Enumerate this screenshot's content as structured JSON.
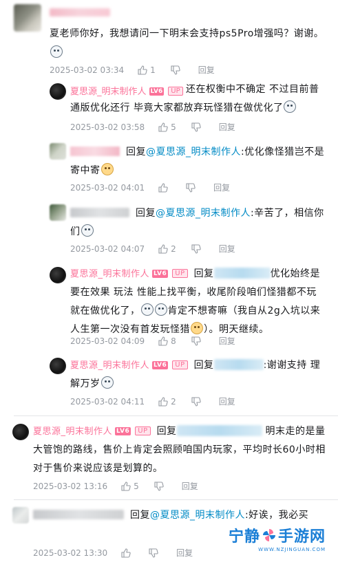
{
  "main_comment": {
    "text": "夏老师你好，我想请问一下明末会支持ps5Pro增强吗？谢谢。",
    "time": "2025-03-02 03:34",
    "likes": "1",
    "reply_label": "回复"
  },
  "replies": [
    {
      "nickname": "夏思源_明末制作人",
      "level": "LV6",
      "up": "UP",
      "text": "还在权衡中不确定 不过目前普通版优化还行 毕竟大家都放弃玩怪猎在做优化了",
      "time": "2025-03-02 03:58",
      "likes": "5",
      "reply_label": "回复"
    },
    {
      "prefix": "回复",
      "mention": "@夏思源_明末制作人",
      "text": ":优化像怪猎岂不是寄中寄",
      "time": "2025-03-02 04:01",
      "likes": "",
      "reply_label": "回复"
    },
    {
      "prefix": "回复",
      "mention": "@夏思源_明末制作人",
      "text": ":辛苦了，相信你们",
      "time": "2025-03-02 04:07",
      "likes": "2",
      "reply_label": "回复"
    },
    {
      "nickname": "夏思源_明末制作人",
      "level": "LV6",
      "up": "UP",
      "prefix": "回复",
      "text_a": "优化始终是要在效果 玩法 性能上找平衡，收尾阶段咱们怪猎都不玩就在做优化了，",
      "text_b": "肯定不想寄嘛（我自从2g入坑以来人生第一次没有首发玩怪猎",
      "text_c": "）。明天继续。",
      "time": "2025-03-02 04:09",
      "likes": "8",
      "reply_label": "回复"
    },
    {
      "nickname": "夏思源_明末制作人",
      "level": "LV6",
      "up": "UP",
      "prefix": "回复",
      "text": ":谢谢支持 理解万岁",
      "time": "2025-03-02 04:11",
      "likes": "2",
      "reply_label": "回复"
    }
  ],
  "comment_2": {
    "nickname": "夏思源_明末制作人",
    "level": "LV6",
    "up": "UP",
    "prefix": "回复",
    "text_a": "明末走的是量大管饱的路线，售价上肯定会照顾咱国内玩家，平均时长60小时相对于售价来说应该是划算的。",
    "time": "2025-03-02 13:16",
    "likes": "5",
    "reply_label": "回复"
  },
  "comment_3": {
    "prefix": "回复",
    "mention": "@夏思源_明末制作人",
    "text": ":好诶，我必买",
    "time": "2025-03-02 13:30",
    "likes": "",
    "reply_label": "回复"
  },
  "watermark": {
    "main_left": "宁静",
    "main_right": "手游网",
    "sub": "WWW.NZJINGUAN.COM"
  },
  "colors": {
    "nickname": "#fb7299",
    "mention": "#008ac5",
    "meta": "#9499a0",
    "watermark": "#1b7fd6"
  }
}
